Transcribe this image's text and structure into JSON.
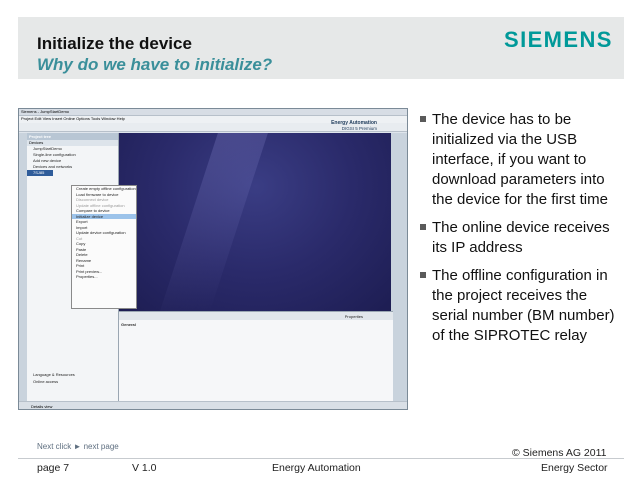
{
  "header": {
    "title": "Initialize the device",
    "subtitle": "Why do we have to initialize?",
    "logo": "SIEMENS"
  },
  "screenshot": {
    "title": "Siemens - JumpStartDemo",
    "menu": "Project  Edit  View  Insert  Online  Options  Tools  Window  Help",
    "brand": "Energy Automation",
    "brand_sub": "DIGSI 5 Premium",
    "tree_header": "Project tree",
    "tree_sub": "Devices",
    "tree_items": [
      "JumpStartDemo",
      "Single-line configuration",
      "Add new device",
      "Devices and networks",
      "7SJ85",
      "Language & Resources",
      "Online access"
    ],
    "context_menu": [
      "Create empty offline configuration",
      "Load firmware to device",
      "Disconnect device",
      "Update offline configuration",
      "Compare to device",
      "Initialize device",
      "Export",
      "Import",
      "Update device configuration",
      "Cut",
      "Copy",
      "Paste",
      "Delete",
      "Rename",
      "Print",
      "Print preview...",
      "Properties..."
    ],
    "props_tab": "General",
    "props_label": "Properties",
    "details": "Details view"
  },
  "bullets": [
    "The device has to be initialized via the USB interface, if you want to download parameters into the device for the first time",
    "The online device receives its IP address",
    "The offline configuration in the project receives the serial number (BM number) of the SIPROTEC relay"
  ],
  "footer": {
    "next": "Next click ► next page",
    "copyright": "© Siemens AG 2011",
    "page": "page 7",
    "version": "V 1.0",
    "division": "Energy Automation",
    "sector": "Energy Sector"
  },
  "colors": {
    "brand": "#009999",
    "subtitle": "#3a8f9a",
    "header_bg": "#e6e8e8"
  }
}
